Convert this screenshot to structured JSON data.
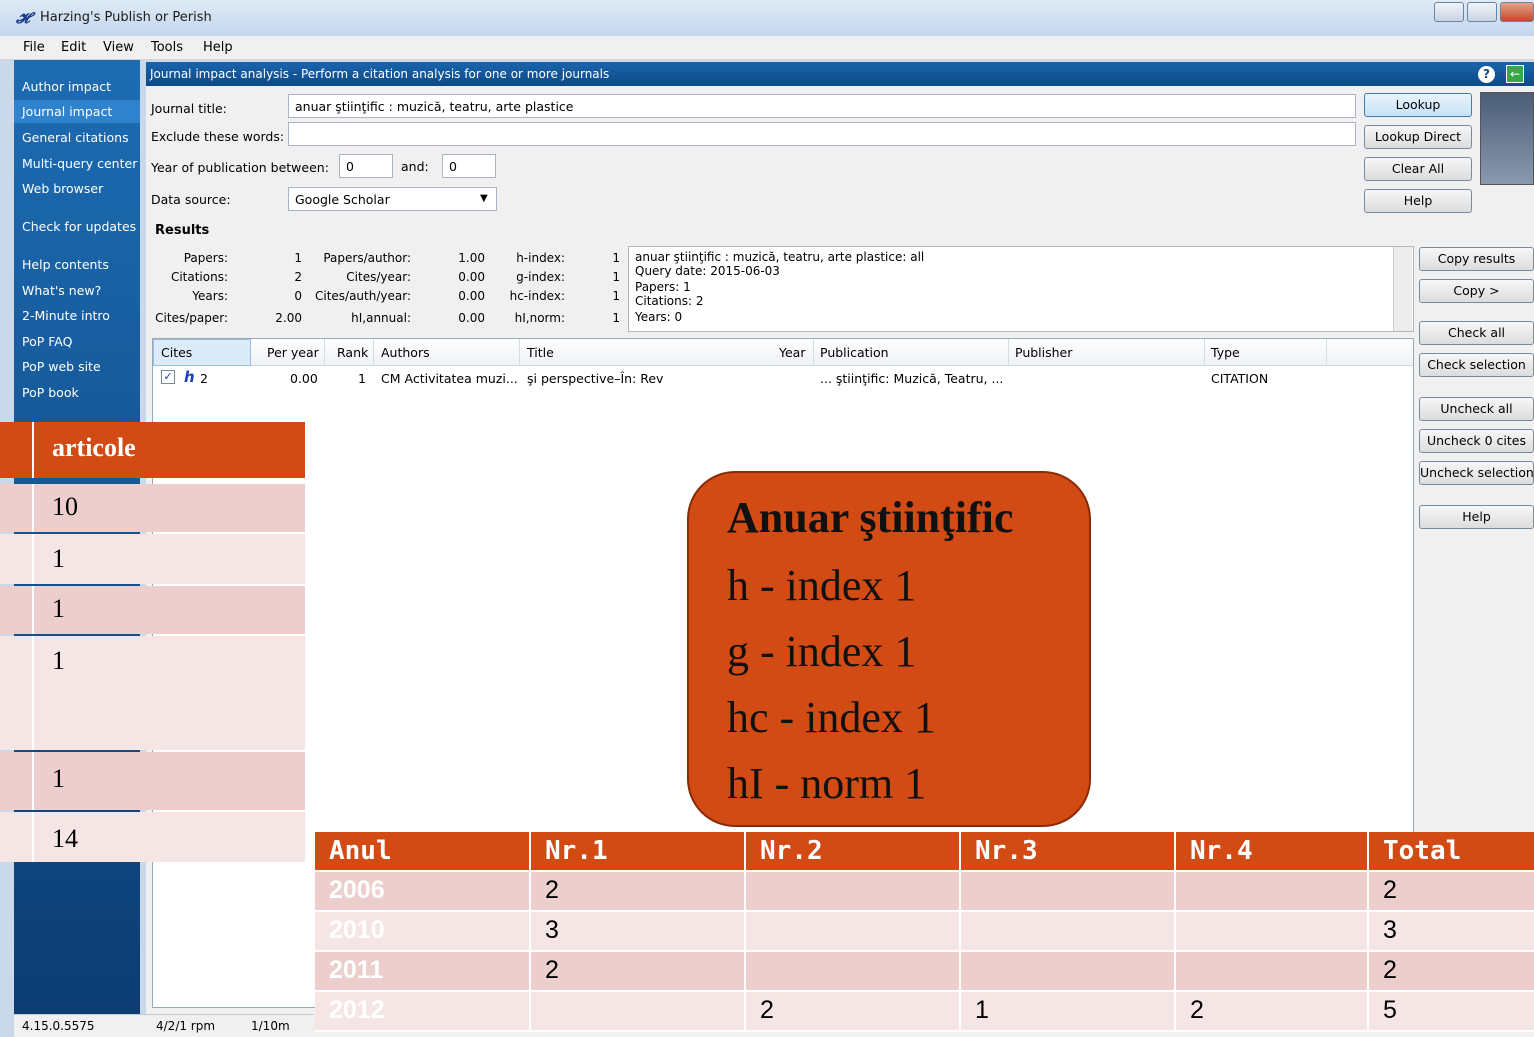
{
  "window": {
    "title": "Harzing's Publish or Perish",
    "logo": "𝓗"
  },
  "menu": [
    "File",
    "Edit",
    "View",
    "Tools",
    "Help"
  ],
  "sidebar": {
    "items": [
      "Author impact",
      "Journal impact",
      "General citations",
      "Multi-query center",
      "Web browser",
      "Check for updates",
      "Help contents",
      "What's new?",
      "2-Minute intro",
      "PoP FAQ",
      "PoP web site",
      "PoP book"
    ]
  },
  "header": {
    "text": "Journal impact analysis - Perform a citation analysis for one or more journals"
  },
  "form": {
    "journal_title_label": "Journal title:",
    "journal_title_value": "anuar ştiinţific : muzică, teatru, arte plastice",
    "exclude_label": "Exclude these words:",
    "exclude_value": "",
    "year_label": "Year of publication between:",
    "year_from": "0",
    "year_and": "and:",
    "year_to": "0",
    "source_label": "Data source:",
    "source_value": "Google Scholar"
  },
  "buttons": {
    "lookup": "Lookup",
    "lookup_direct": "Lookup Direct",
    "clear_all": "Clear All",
    "help": "Help",
    "copy_results": "Copy results",
    "copy": "Copy >",
    "check_all": "Check all",
    "check_selection": "Check selection",
    "uncheck_all": "Uncheck all",
    "uncheck_0": "Uncheck 0 cites",
    "uncheck_selection": "Uncheck selection",
    "help2": "Help"
  },
  "results": {
    "title": "Results",
    "papers_label": "Papers:",
    "papers": "1",
    "citations_label": "Citations:",
    "citations": "2",
    "years_label": "Years:",
    "years": "0",
    "cites_paper_label": "Cites/paper:",
    "cites_paper": "2.00",
    "papers_author_label": "Papers/author:",
    "papers_author": "1.00",
    "cites_year_label": "Cites/year:",
    "cites_year": "0.00",
    "cites_auth_year_label": "Cites/auth/year:",
    "cites_auth_year": "0.00",
    "hi_annual_label": "hI,annual:",
    "hi_annual": "0.00",
    "h_index_label": "h-index:",
    "h_index": "1",
    "g_index_label": "g-index:",
    "g_index": "1",
    "hc_index_label": "hc-index:",
    "hc_index": "1",
    "hi_norm_label": "hI,norm:",
    "hi_norm": "1",
    "query_lines": [
      "anuar ştiinţific : muzică, teatru, arte plastice: all",
      "Query date: 2015-06-03",
      "Papers: 1",
      "Citations: 2",
      "Years: 0"
    ]
  },
  "grid": {
    "columns": [
      "Cites",
      "Per year",
      "Rank",
      "Authors",
      "Title",
      "Year",
      "Publication",
      "Publisher",
      "Type"
    ],
    "row": {
      "h": "h",
      "cites": "2",
      "per_year": "0.00",
      "rank": "1",
      "authors": "CM Activitatea muzi...",
      "title": "şi perspective–În: Rev",
      "year": "",
      "publication": "... ştiinţific: Muzică, Teatru, ...",
      "publisher": "",
      "type": "CITATION"
    }
  },
  "status": {
    "version": "4.15.0.5575",
    "rpm": "4/2/1 rpm",
    "rate": "1/10m"
  },
  "articole_table": {
    "header": "articole",
    "values": [
      "10",
      "1",
      "1",
      "1",
      "1",
      "14"
    ]
  },
  "callout": {
    "title": "Anuar ştiinţific",
    "lines": [
      "h - index 1",
      "g - index 1",
      "hc - index 1",
      "hI - norm 1"
    ]
  },
  "year_table": {
    "headers": [
      "Anul",
      "Nr.1",
      "Nr.2",
      "Nr.3",
      "Nr.4",
      "Total"
    ],
    "rows": [
      [
        "2006",
        "2",
        "",
        "",
        "",
        "2"
      ],
      [
        "2010",
        "3",
        "",
        "",
        "",
        "3"
      ],
      [
        "2011",
        "2",
        "",
        "",
        "",
        "2"
      ],
      [
        "2012",
        "",
        "2",
        "1",
        "2",
        "5"
      ]
    ]
  },
  "colors": {
    "accent": "#d24a14",
    "row_even": "#eccfcd",
    "row_odd": "#f5e6e5",
    "sidebar": "#1d6cb3"
  }
}
